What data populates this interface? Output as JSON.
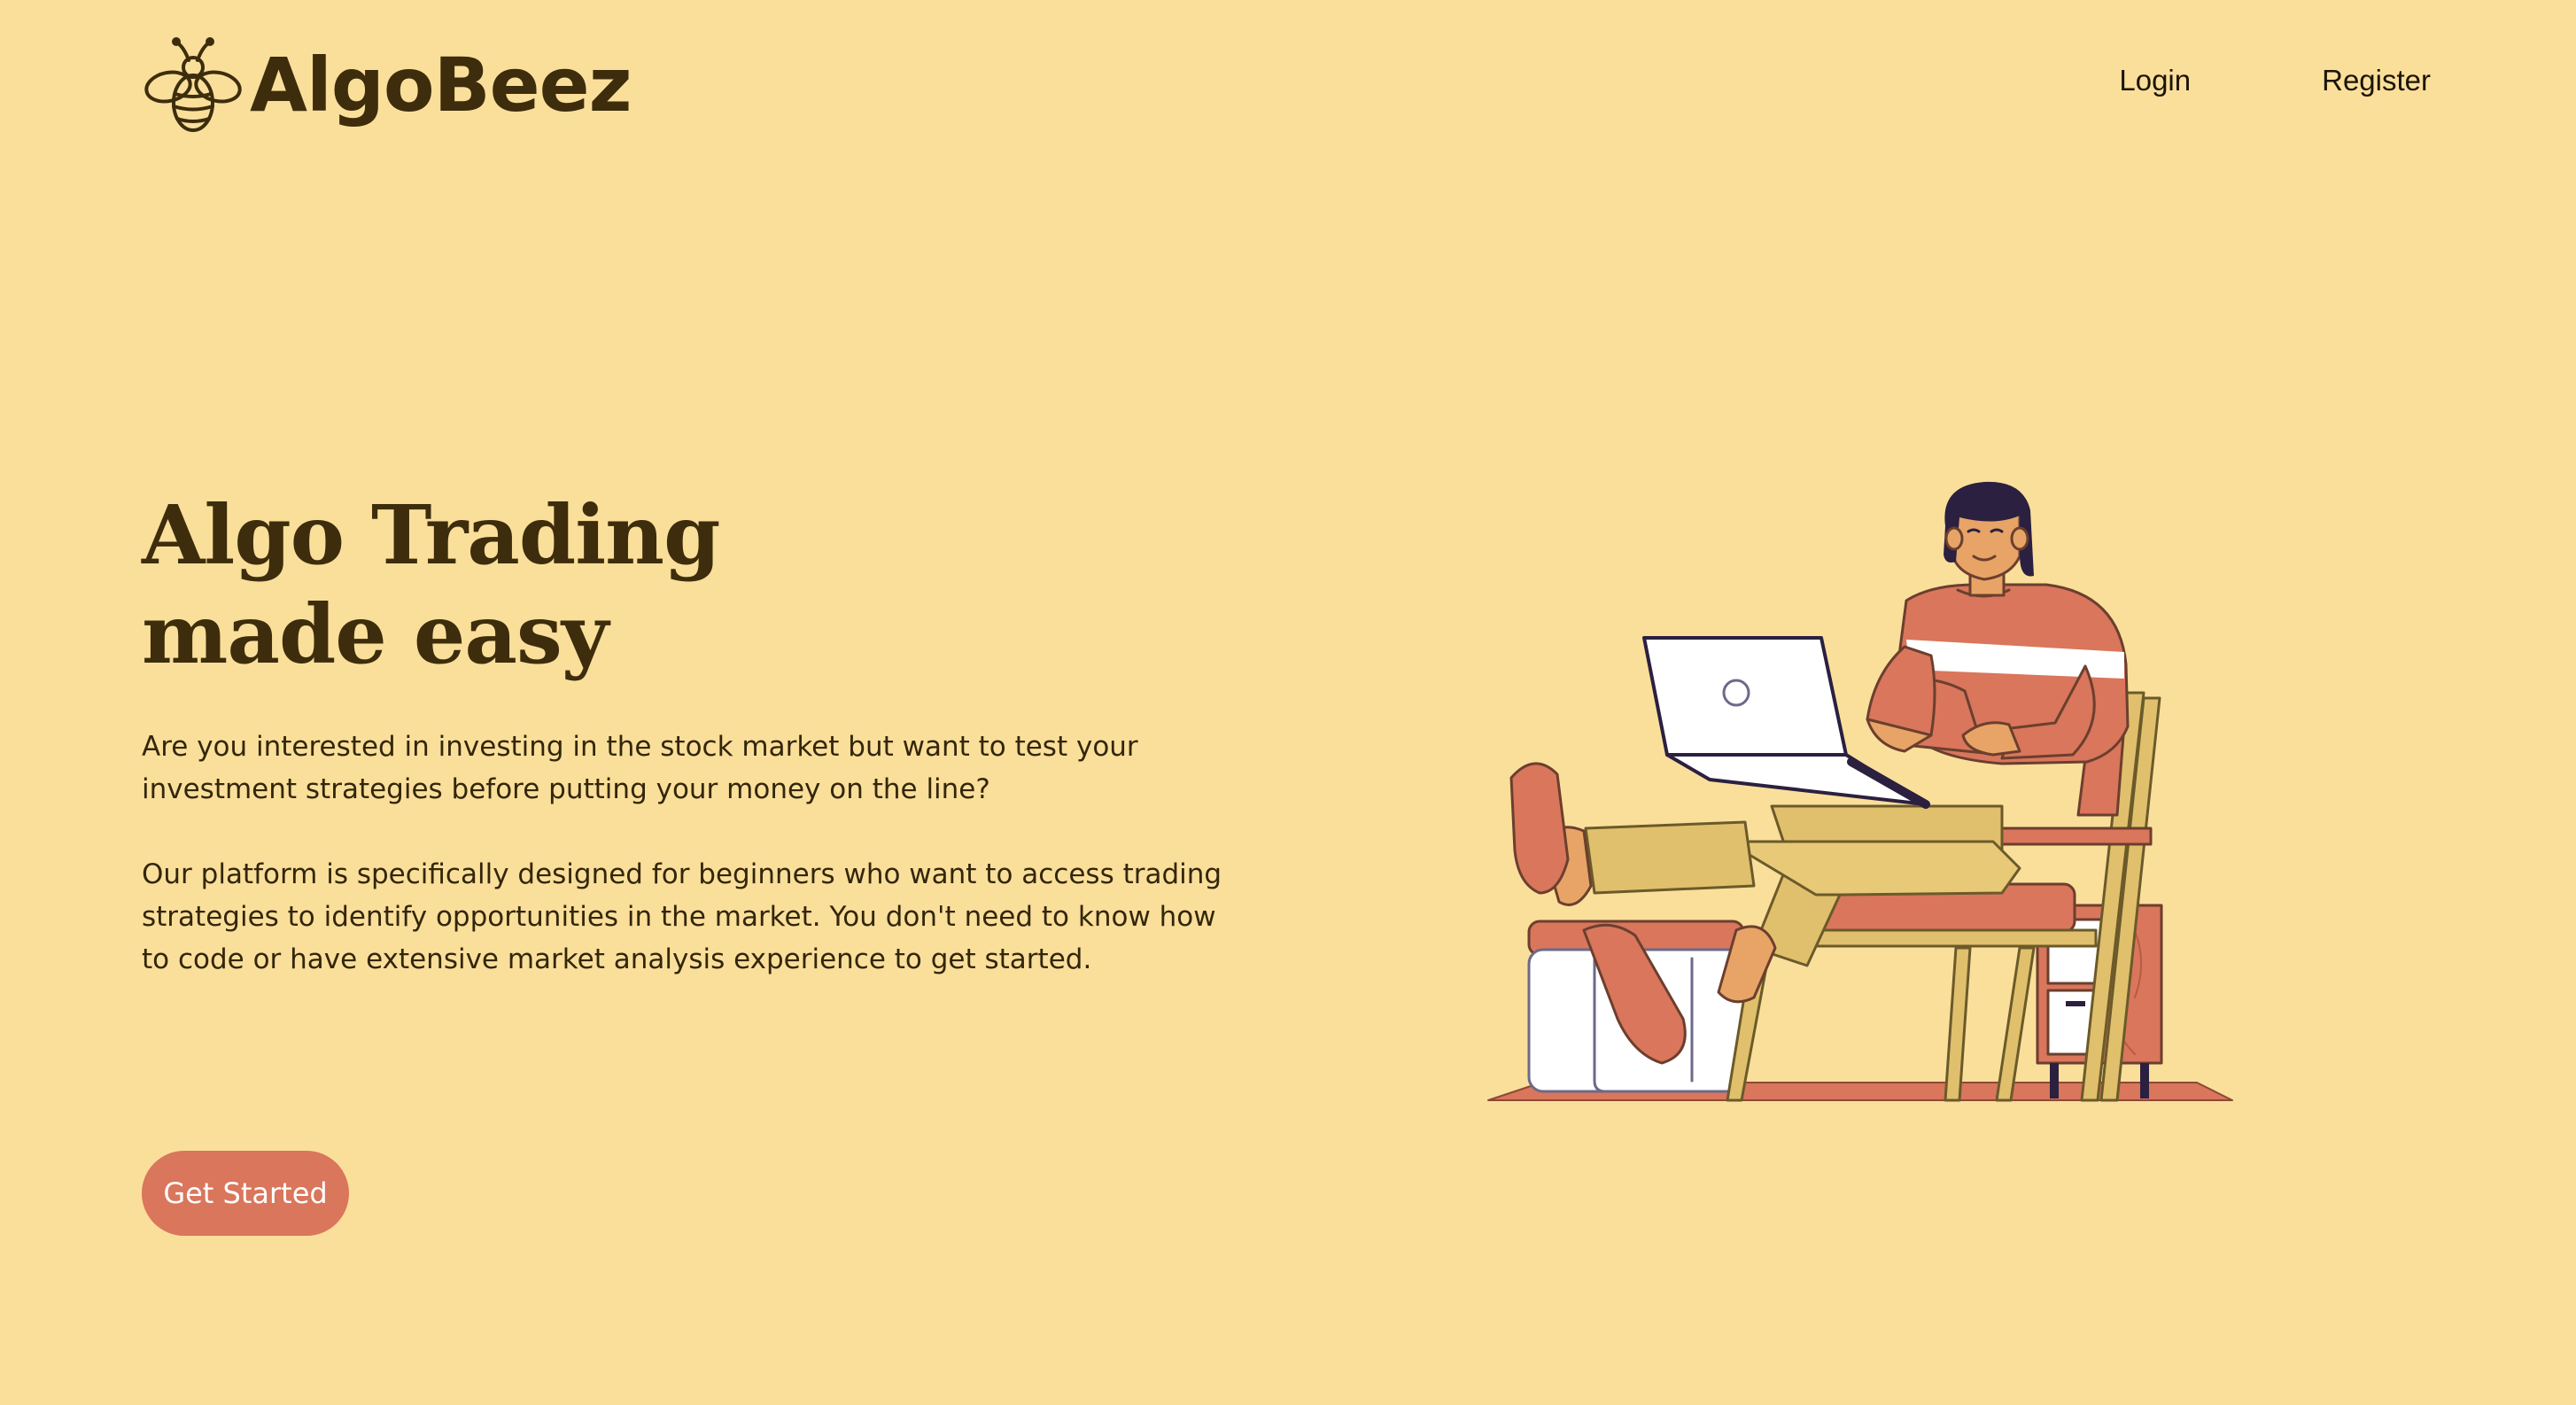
{
  "header": {
    "brand": "AlgoBeez",
    "logo_icon": "bee-icon",
    "nav": {
      "login": "Login",
      "register": "Register"
    }
  },
  "hero": {
    "title_line1": "Algo Trading",
    "title_line2": "made easy",
    "paragraph1": "Are you interested in investing in the stock market but want to test your investment strategies before putting your money on the line?",
    "paragraph2": "Our platform is specifically designed for beginners who want to access trading strategies to identify opportunities in the market. You don't need to know how to code or have extensive market analysis experience to get started.",
    "cta_label": "Get Started"
  },
  "illustration": {
    "name": "person-with-laptop-illustration"
  },
  "colors": {
    "background": "#fadf9b",
    "text": "#3d2d0c",
    "accent": "#d9765c",
    "button_text": "#ffffff"
  }
}
